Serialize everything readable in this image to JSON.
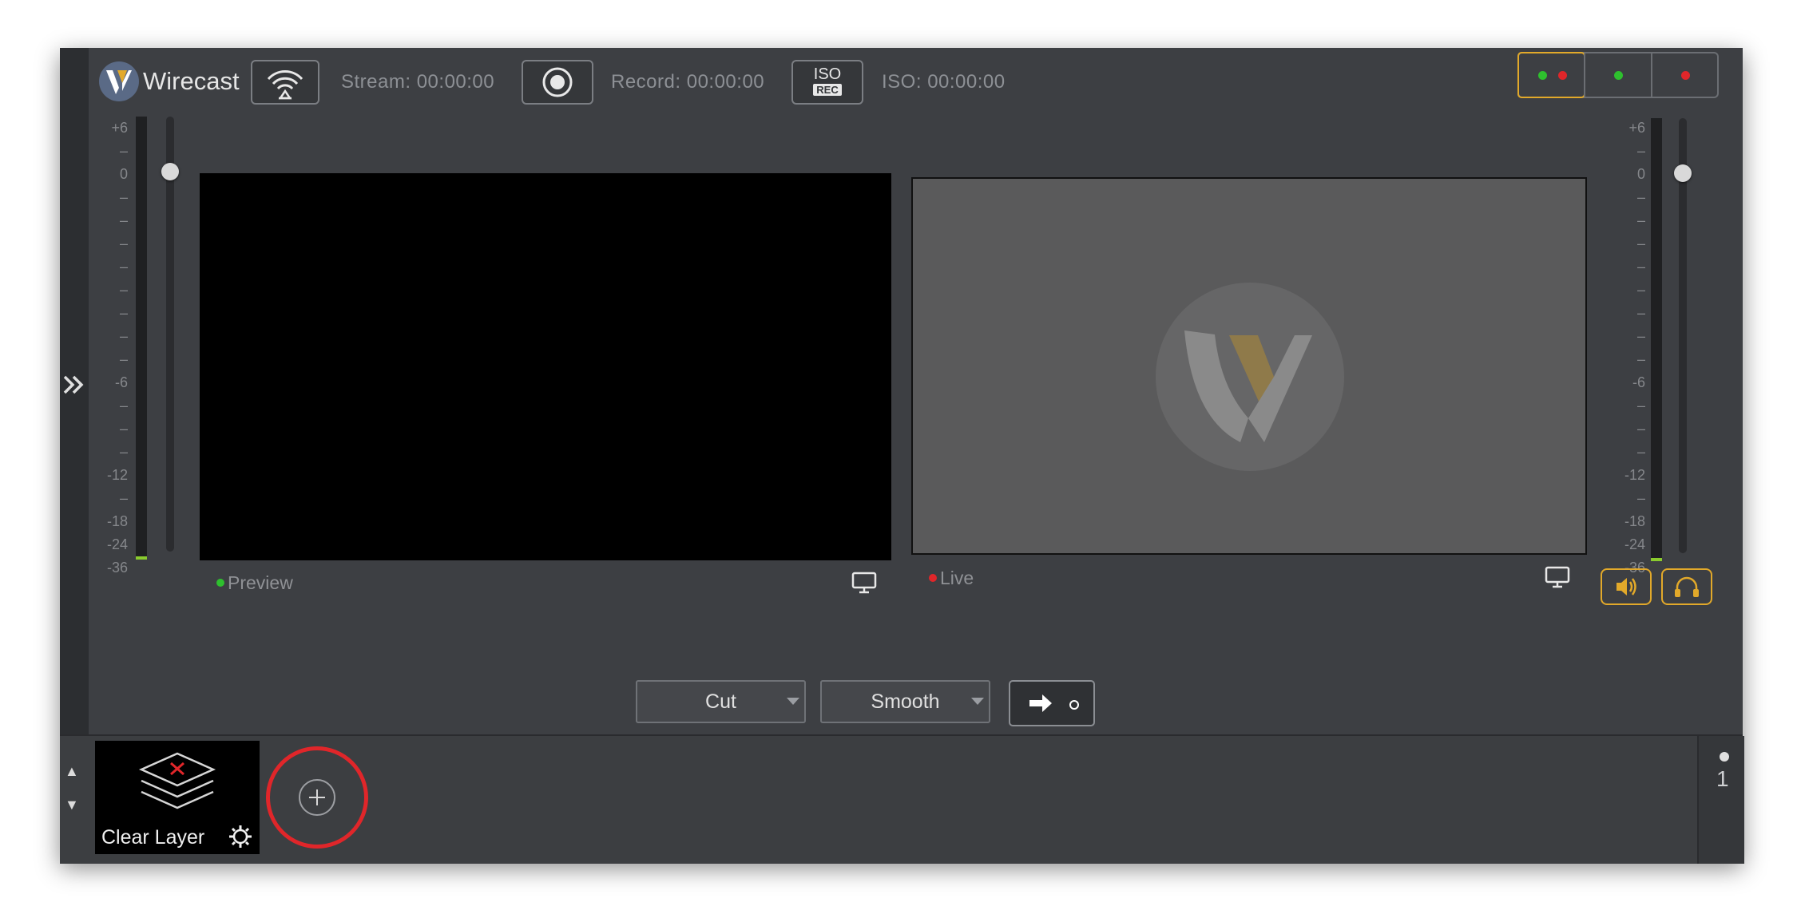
{
  "app": {
    "title": "Wirecast"
  },
  "toolbar": {
    "stream_label": "Stream:",
    "stream_time": "00:00:00",
    "record_label": "Record:",
    "record_time": "00:00:00",
    "iso_label": "ISO:",
    "iso_time": "00:00:00",
    "iso_badge_top": "ISO",
    "iso_badge_bottom": "REC"
  },
  "meter_scale": [
    "+6",
    "–",
    "0",
    "–",
    "–",
    "–",
    "–",
    "–",
    "–",
    "–",
    "–",
    "-6",
    "–",
    "–",
    "–",
    "-12",
    "–",
    "-18",
    "-24",
    "-36"
  ],
  "volume_level": 0.91,
  "viewers": {
    "preview_label": "Preview",
    "live_label": "Live"
  },
  "transitions": {
    "transition1": "Cut",
    "transition2": "Smooth"
  },
  "shots": [
    {
      "name": "Clear Layer"
    }
  ],
  "layer": {
    "number": "1"
  },
  "colors": {
    "accent": "#e2a92a",
    "status_green": "#2ec02e",
    "status_red": "#e0262a",
    "highlight": "#e0262a"
  }
}
